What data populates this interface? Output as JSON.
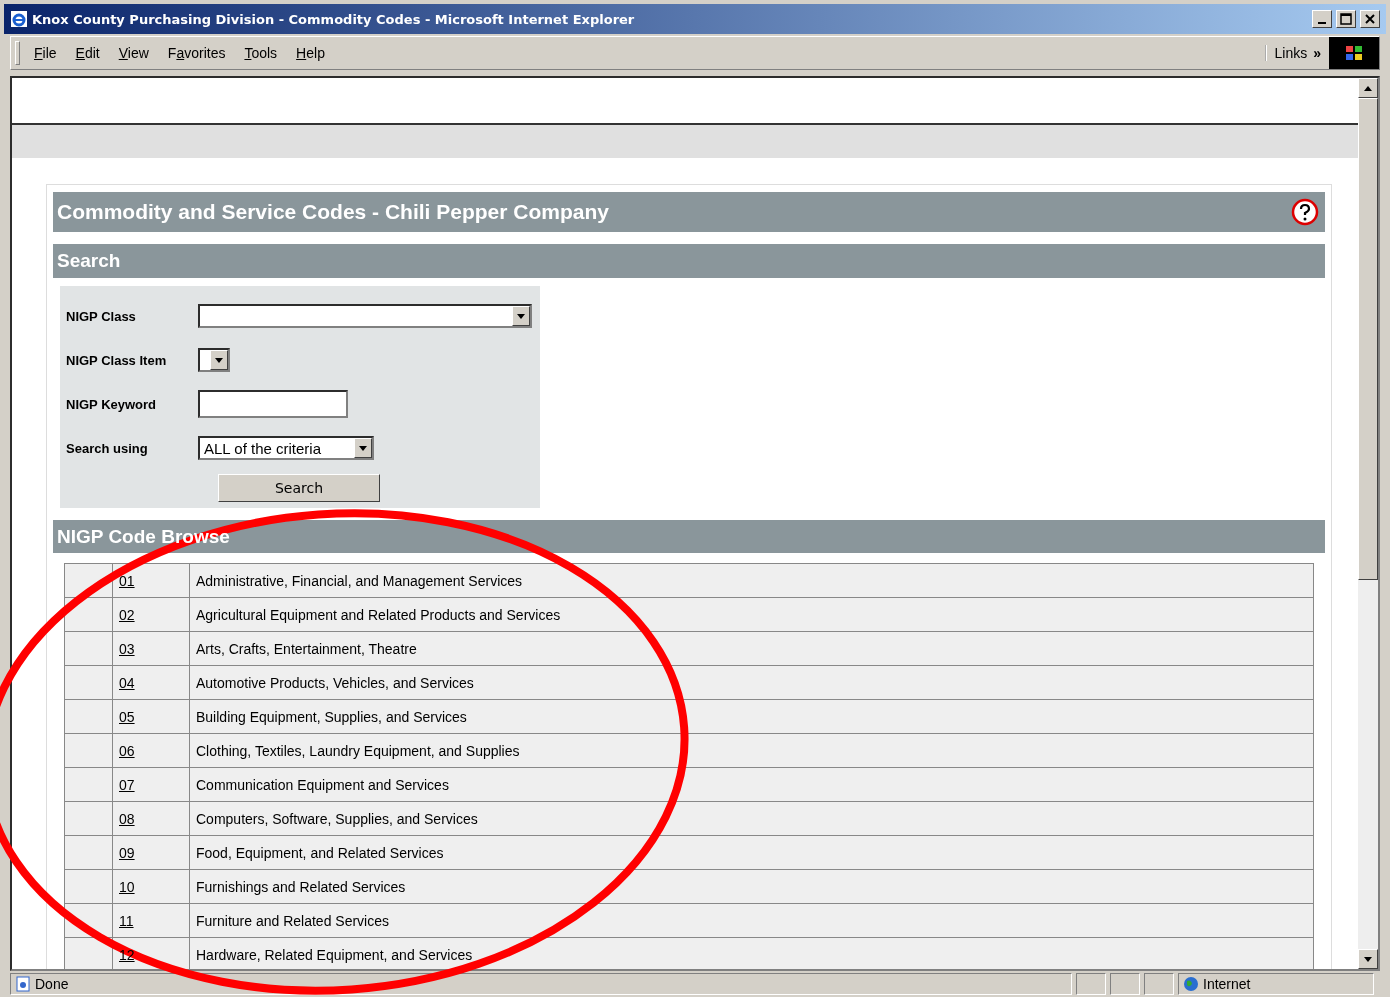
{
  "window": {
    "title": "Knox County Purchasing Division - Commodity Codes - Microsoft Internet Explorer"
  },
  "menu": [
    {
      "key": "F",
      "post": "ile"
    },
    {
      "key": "E",
      "post": "dit"
    },
    {
      "key": "V",
      "post": "iew"
    },
    {
      "pre": "F",
      "key": "a",
      "post": "vorites"
    },
    {
      "key": "T",
      "post": "ools"
    },
    {
      "key": "H",
      "post": "elp"
    }
  ],
  "links": {
    "label": "Links",
    "chevron": "»"
  },
  "page": {
    "title": "Commodity and Service Codes - Chili Pepper Company",
    "search": {
      "heading": "Search",
      "fields": [
        {
          "kind": "select",
          "label": "NIGP Class"
        },
        {
          "kind": "select",
          "label": "NIGP Class Item"
        },
        {
          "kind": "input",
          "label": "NIGP Keyword"
        },
        {
          "kind": "select",
          "label": "Search using",
          "value": "ALL of the criteria"
        }
      ],
      "button": "Search"
    },
    "browse": {
      "heading": "NIGP Code Browse",
      "rows": [
        {
          "code": "01",
          "description": "Administrative, Financial, and Management Services"
        },
        {
          "code": "02",
          "description": "Agricultural Equipment and Related Products and Services"
        },
        {
          "code": "03",
          "description": "Arts, Crafts, Entertainment, Theatre"
        },
        {
          "code": "04",
          "description": "Automotive Products, Vehicles, and Services"
        },
        {
          "code": "05",
          "description": "Building Equipment, Supplies, and Services"
        },
        {
          "code": "06",
          "description": "Clothing, Textiles, Laundry Equipment, and Supplies"
        },
        {
          "code": "07",
          "description": "Communication Equipment and Services"
        },
        {
          "code": "08",
          "description": "Computers, Software, Supplies, and Services"
        },
        {
          "code": "09",
          "description": "Food, Equipment, and Related Services"
        },
        {
          "code": "10",
          "description": "Furnishings and Related Services"
        },
        {
          "code": "11",
          "description": "Furniture and Related Services"
        },
        {
          "code": "12",
          "description": "Hardware, Related Equipment, and Services"
        }
      ]
    }
  },
  "status_bar": {
    "status": "Done",
    "zone": "Internet"
  }
}
